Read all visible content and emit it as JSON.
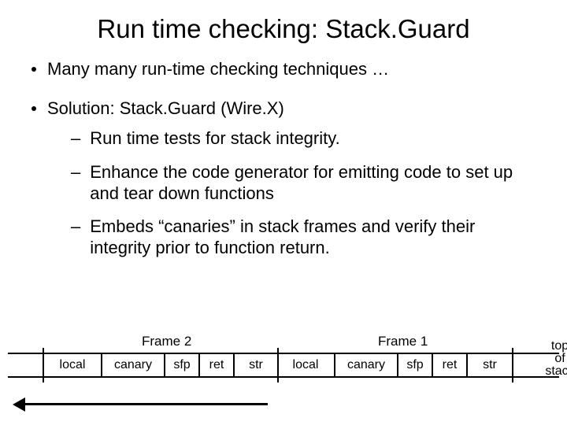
{
  "title": "Run time checking: Stack.Guard",
  "bullets": {
    "b1": "Many many run-time checking techniques …",
    "b2": "Solution:  Stack.Guard  (Wire.X)"
  },
  "subs": {
    "s1": "Run time tests for stack integrity.",
    "s2": "Enhance the code generator for emitting code to set up and tear down functions",
    "s3": "Embeds “canaries” in stack frames and verify their integrity prior to function return."
  },
  "diagram": {
    "frame2_label": "Frame 2",
    "frame1_label": "Frame 1",
    "top_of_stack": "top\nof\nstack",
    "cells": {
      "local1": "local",
      "canary1": "canary",
      "sfp1": "sfp",
      "ret1": "ret",
      "str1": "str",
      "local2": "local",
      "canary2": "canary",
      "sfp2": "sfp",
      "ret2": "ret",
      "str2": "str"
    }
  }
}
